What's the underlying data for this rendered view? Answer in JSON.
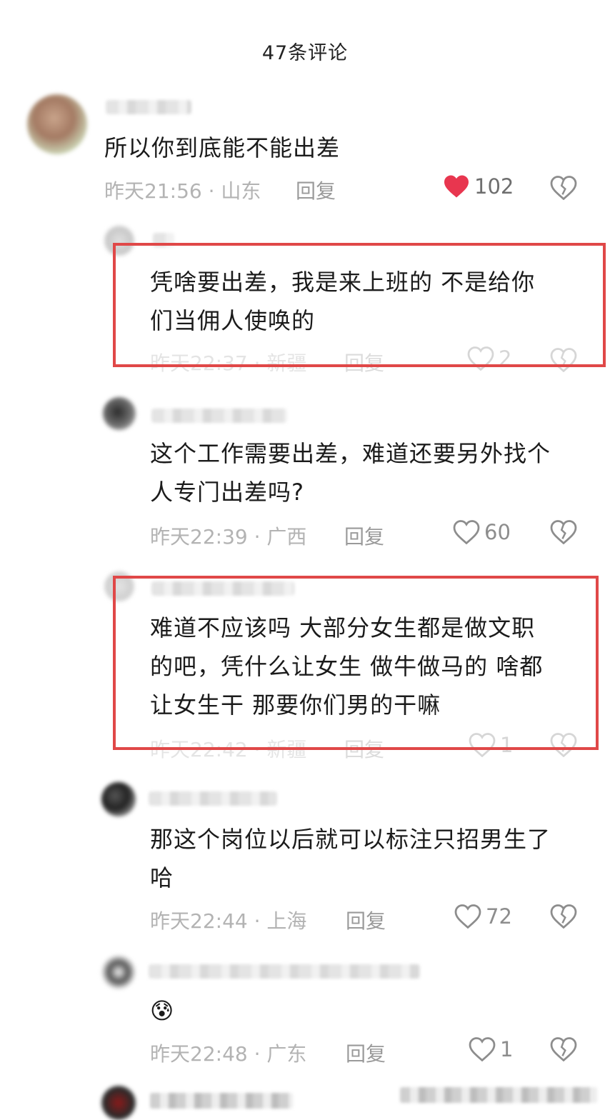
{
  "header": {
    "title": "47条评论"
  },
  "comments": [
    {
      "text": "所以你到底能不能出差",
      "meta": "昨天21:56 · 山东",
      "reply": "回复",
      "likes": "102",
      "liked": true
    },
    {
      "text": "凭啥要出差，我是来上班的 不是给你\n们当佣人使唤的",
      "meta": "昨天22:37 · 新疆",
      "reply": "回复",
      "likes": "2",
      "liked": false
    },
    {
      "text": "这个工作需要出差，难道还要另外找个\n人专门出差吗?",
      "meta": "昨天22:39 · 广西",
      "reply": "回复",
      "likes": "60",
      "liked": false
    },
    {
      "text": "难道不应该吗 大部分女生都是做文职\n的吧，凭什么让女生 做牛做马的 啥都\n让女生干 那要你们男的干嘛",
      "meta": "昨天22:42 · 新疆",
      "reply": "回复",
      "likes": "1",
      "liked": false
    },
    {
      "text": "那这个岗位以后就可以标注只招男生了\n哈",
      "meta": "昨天22:44 · 上海",
      "reply": "回复",
      "likes": "72",
      "liked": false
    },
    {
      "text": "😰",
      "meta": "昨天22:48 · 广东",
      "reply": "回复",
      "likes": "1",
      "liked": false
    }
  ],
  "colors": {
    "highlight": "#e04848",
    "liked_heart": "#e8364f",
    "meta": "#b3b3b3"
  },
  "icons": {
    "like": "heart-icon",
    "dislike": "broken-heart-icon"
  }
}
